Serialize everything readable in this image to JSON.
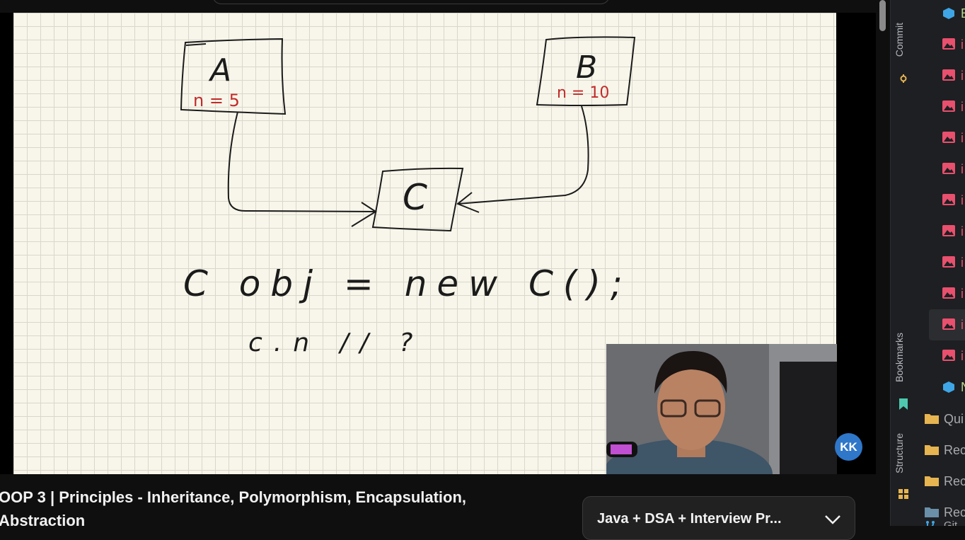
{
  "video": {
    "title": "OOP 3 | Principles - Inheritance, Polymorphism, Encapsulation, Abstraction",
    "channel_badge": "KK"
  },
  "whiteboard": {
    "box_a_label": "A",
    "box_a_value": "n = 5",
    "box_b_label": "B",
    "box_b_value": "n = 10",
    "box_c_label": "C",
    "code_line_1": "C obj = new C();",
    "code_line_2": "c.n // ?"
  },
  "playlist": {
    "title": "Java + DSA + Interview Pr...",
    "expand_icon": "chevron-down-icon"
  },
  "ide": {
    "tool_tabs": [
      "Commit",
      "Bookmarks",
      "Structure"
    ],
    "tree_items": [
      {
        "icon": "module-icon",
        "label": "E"
      },
      {
        "icon": "image-file-icon",
        "label": "i"
      },
      {
        "icon": "image-file-icon",
        "label": "i"
      },
      {
        "icon": "image-file-icon",
        "label": "i"
      },
      {
        "icon": "image-file-icon",
        "label": "i"
      },
      {
        "icon": "image-file-icon",
        "label": "i"
      },
      {
        "icon": "image-file-icon",
        "label": "i"
      },
      {
        "icon": "image-file-icon",
        "label": "i"
      },
      {
        "icon": "image-file-icon",
        "label": "i"
      },
      {
        "icon": "image-file-icon",
        "label": "i"
      },
      {
        "icon": "image-file-icon",
        "label": "i"
      },
      {
        "icon": "image-file-icon",
        "label": "i"
      },
      {
        "icon": "module-icon",
        "label": "N"
      }
    ],
    "folders": [
      "Qui",
      "Rec",
      "Rec",
      "Rec",
      "Git"
    ]
  },
  "colors": {
    "board": "#f8f6ea",
    "ink": "#1b1b1b",
    "red_ink": "#c22a2a",
    "image_icon": "#e8506e",
    "module_icon": "#3ea6e6",
    "folder_icon": "#e6b450",
    "accent_blue": "#2f77c9"
  }
}
